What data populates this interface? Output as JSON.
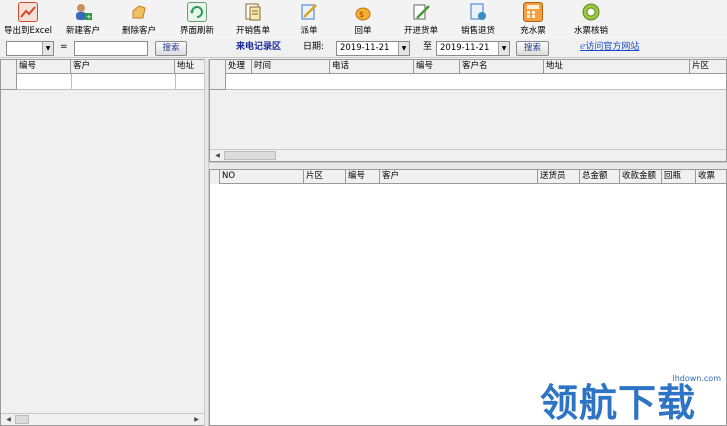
{
  "toolbar": {
    "buttons": [
      {
        "label": "导出到Excel",
        "icon": "excel-export-icon",
        "color": "#d04a2a"
      },
      {
        "label": "新建客户",
        "icon": "new-customer-icon",
        "color": "#2a8a3a"
      },
      {
        "label": "删除客户",
        "icon": "delete-customer-icon",
        "color": "#e0a030"
      },
      {
        "label": "界面刷新",
        "icon": "refresh-icon",
        "color": "#2a9a5a"
      },
      {
        "label": "开销售单",
        "icon": "sales-order-icon",
        "color": "#c89020"
      },
      {
        "label": "派单",
        "icon": "dispatch-icon",
        "color": "#3a7ac8"
      },
      {
        "label": "回单",
        "icon": "receipt-icon",
        "color": "#e8a020"
      },
      {
        "label": "开进货单",
        "icon": "purchase-order-icon",
        "color": "#5a8a4a"
      },
      {
        "label": "销售退货",
        "icon": "sales-return-icon",
        "color": "#3a8ac8"
      },
      {
        "label": "充水票",
        "icon": "water-ticket-icon",
        "color": "#e07820"
      },
      {
        "label": "水票核销",
        "icon": "ticket-writeoff-icon",
        "color": "#7ab030"
      }
    ]
  },
  "search": {
    "eq_label": "=",
    "search_button": "搜索",
    "incoming_label": "来电记录区",
    "date_label": "日期:",
    "date_from": "2019-11-21",
    "to_label": "至",
    "date_to": "2019-11-21",
    "search_button2": "搜索",
    "website_link": "访问官方网站"
  },
  "customer_grid": {
    "columns": [
      "编号",
      "客户",
      "地址"
    ]
  },
  "call_grid": {
    "columns": [
      "处理",
      "时间",
      "电话",
      "编号",
      "客户名",
      "地址",
      "片区"
    ]
  },
  "order_grid": {
    "columns": [
      "NO",
      "片区",
      "编号",
      "客户",
      "送货员",
      "总金额",
      "收款金额",
      "回瓶",
      "收票"
    ]
  },
  "watermark": {
    "url": "lhdown.com",
    "text": "领航下载"
  }
}
